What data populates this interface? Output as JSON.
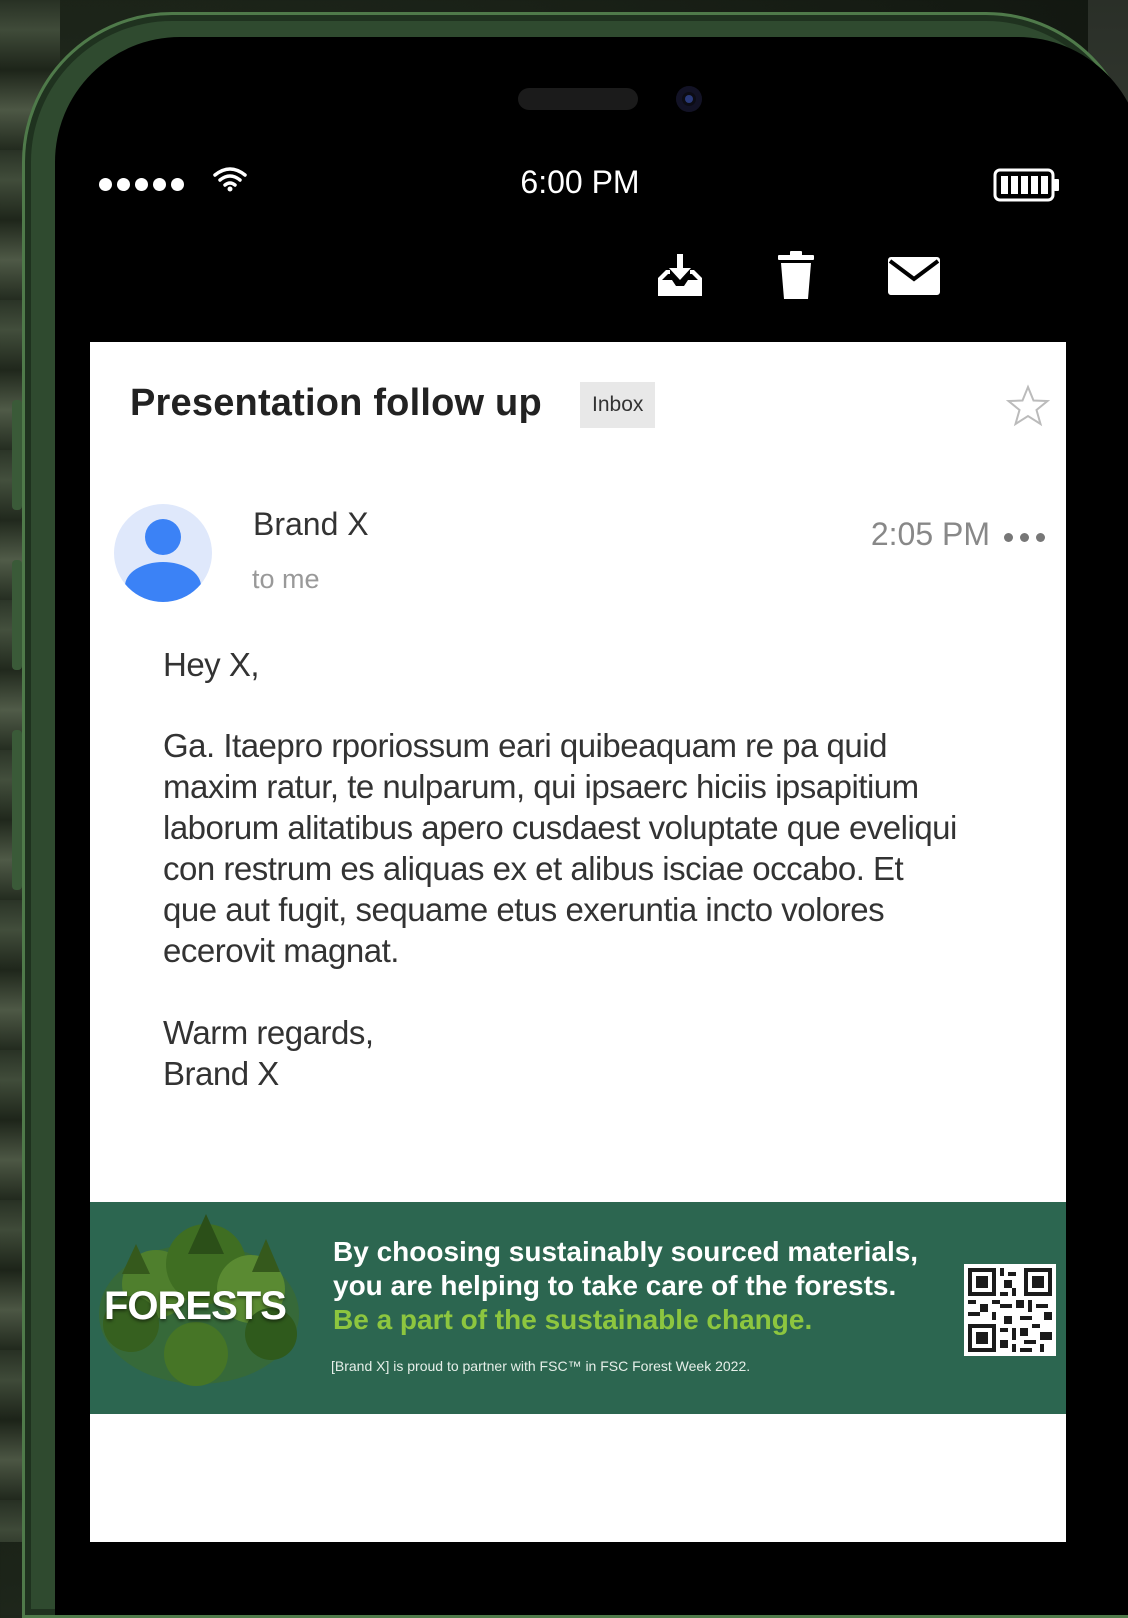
{
  "status_bar": {
    "time": "6:00 PM"
  },
  "toolbar": {
    "archive_icon": "archive-down-icon",
    "delete_icon": "trash-icon",
    "mark_unread_icon": "envelope-icon"
  },
  "email": {
    "subject": "Presentation follow up",
    "label": "Inbox",
    "sender": "Brand X",
    "recipients": "to me",
    "time": "2:05 PM",
    "greeting": "Hey X,",
    "paragraph_lines": [
      "Ga. Itaepro rporiossum eari quibeaquam re pa quid",
      "maxim ratur, te nulparum, qui ipsaerc hiciis ipsapitium",
      "laborum alitatibus apero cusdaest voluptate que eveliqui",
      "con restrum es aliquas ex et alibus isciae occabo. Et",
      "que aut fugit, sequame etus exeruntia incto volores",
      "ecerovit magnat."
    ],
    "signoff": "Warm regards,",
    "signature": "Brand X"
  },
  "banner": {
    "logo_text": "FORESTS",
    "line1": "By choosing sustainably sourced materials,",
    "line2": "you are helping to take care of the forests.",
    "line3": "Be a part of the sustainable change.",
    "fine_print": "[Brand X] is proud to partner with FSC™ in FSC Forest Week 2022.",
    "background_color": "#2c6650",
    "accent_color": "#8dc63f"
  },
  "colors": {
    "avatar_blue": "#3b82f6",
    "phone_frame": "#2f4a2f"
  }
}
